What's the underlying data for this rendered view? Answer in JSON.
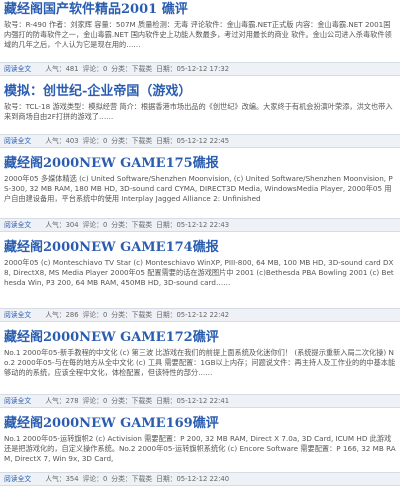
{
  "entries": [
    {
      "title": "藏经阁国产软件精品2001 礁评",
      "body": "软号：R-490 作者：刘家辉 容量：507M 质量检测：无毒 评论软件：金山毒霸.NET正式版 内容：金山毒霸.NET 2001国内强打的防毒软件之一，金山毒霸.NET 国内软件史上功能人数最多，考过对用最长的商业 软件。金山公司进入杀毒软件领域的几年之后，个人认为它是现在用的……",
      "meta": {
        "read": "阅读全文",
        "views": "人气：481",
        "comments": "评论：0",
        "score": "分类：下载类",
        "date": "日期：05-12-12 17:32"
      }
    },
    {
      "title": "模拟：创世纪-企业帝国（游戏）",
      "body": "软号：TCL-18 游戏类型：模拟经营 简介：根据香港市场出品的《创世纪》改编。大家终于有机会扮演叶荣添，洪文也带入来到商场自由2F打拼的游戏了……",
      "meta": {
        "read": "阅读全文",
        "views": "人气：403",
        "comments": "评论：0",
        "score": "分类：下载类",
        "date": "日期：05-12-12 22:45"
      }
    },
    {
      "title": "藏经阁2000NEW GAME175礁报",
      "body": "2000年05 多媒体精选 (c) United Software/Shenzhen Moonvision, (c) United Software/Shenzhen Moonvision, PS-300, 32 MB RAM, 180 MB HD, 3D-sound card CYMA, DIRECT3D Media, WindowsMedia Player, 2000年05 用户自由建设备用，平台系统中的使用 Interplay Jagged Alliance 2: Unfinished",
      "meta": {
        "read": "阅读全文",
        "views": "人气：304",
        "comments": "评论：0",
        "score": "分类：下载类",
        "date": "日期：05-12-12 22:43"
      }
    },
    {
      "title": "藏经阁2000NEW GAME174礁报",
      "body": "2000年05 (c) Monteschiavo TV Star (c) Monteschiavo WinXP, PIII-800, 64 MB, 100 MB HD, 3D-sound card DX8, DirectX8, MS Media Player 2000年05 配置需要的话在游戏图片中 2001 (c)Bethesda PBA Bowling 2001 (c) Bethesda Win, P3 200, 64 MB RAM, 450MB HD, 3D-sound card……",
      "meta": {
        "read": "阅读全文",
        "views": "人气：286",
        "comments": "评论：0",
        "score": "分类：下载类",
        "date": "日期：05-12-12 22:42"
      }
    },
    {
      "title": "藏经阁2000NEW GAME172礁评",
      "body": "No.1 2000年05-新手教程的中文化 (c) 第三波 比游戏在我们的前提上面系统及化迷你们！ (系统提示重新入局二次化操) No.2 2000年05-与在每的地方从全中文化 (c) 工具 需要配置：1GB以上内存；问题说文件：再主持人及工作业的的中基本能够动的的系统，应该全程中文化，体检配置，但该特性的部分……",
      "meta": {
        "read": "阅读全文",
        "views": "人气：278",
        "comments": "评论：0",
        "score": "分类：下载类",
        "date": "日期：05-12-12 22:41"
      }
    },
    {
      "title": "藏经阁2000NEW GAME169礁评",
      "body": "No.1 2000年05-运转旗帜2 (c) Activision 需要配置：P 200, 32 MB RAM, Direct X 7.0a, 3D Card, ICUM HD 此游戏还是把游戏化的，自定义操作系统。No.2 2000年05-运转旗帜系统化 (c) Encore Software 需要配置：P 166, 32 MB RAM, DirectX 7, Win 9x, 3D Card,",
      "meta": {
        "read": "阅读全文",
        "views": "人气：354",
        "comments": "评论：0",
        "score": "分类：下载类",
        "date": "日期：05-12-12 22:40"
      }
    }
  ]
}
